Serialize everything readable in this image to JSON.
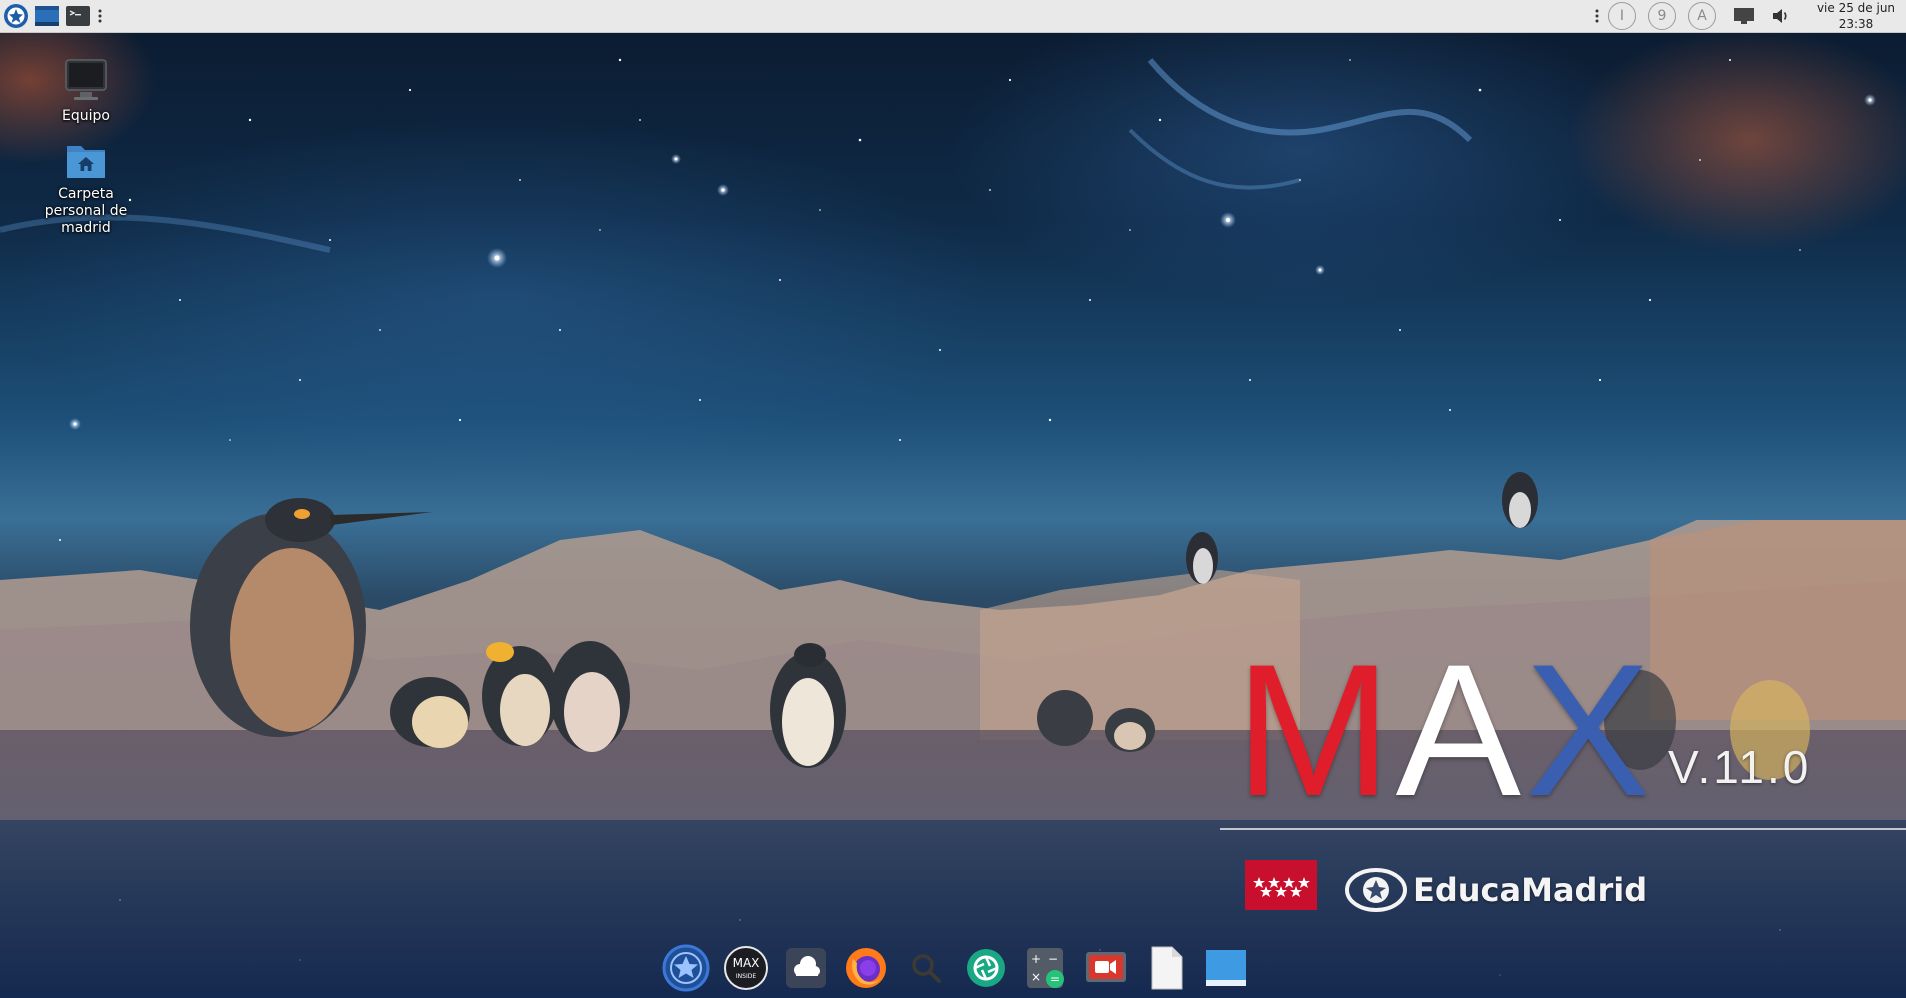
{
  "top_panel": {
    "menu_icon": "max-menu-icon",
    "show_desktop_icon": "show-desktop-icon",
    "terminal_icon": "terminal-icon",
    "indicators": [
      {
        "name": "indicator-i",
        "glyph": "I"
      },
      {
        "name": "indicator-9",
        "glyph": "9"
      },
      {
        "name": "indicator-a",
        "glyph": "A"
      }
    ],
    "clock_date": "vie 25 de jun",
    "clock_time": "23:38"
  },
  "desktop_icons": [
    {
      "label": "Equipo",
      "icon": "computer-icon"
    },
    {
      "label": "Carpeta personal de madrid",
      "icon": "home-folder-icon"
    }
  ],
  "branding": {
    "logo_letters": [
      "M",
      "A",
      "X"
    ],
    "logo_colors": [
      "#e01d2b",
      "#ffffff",
      "#3a5fb0"
    ],
    "version": "V.11.0",
    "organization": "EducaMadrid",
    "flag_color": "#c8102e"
  },
  "dock": [
    {
      "name": "max-launcher-icon"
    },
    {
      "name": "max-inside-icon"
    },
    {
      "name": "nextcloud-icon"
    },
    {
      "name": "firefox-icon"
    },
    {
      "name": "search-icon"
    },
    {
      "name": "screenshot-icon"
    },
    {
      "name": "calculator-icon"
    },
    {
      "name": "screen-recorder-icon"
    },
    {
      "name": "text-editor-icon"
    },
    {
      "name": "file-manager-icon"
    }
  ]
}
